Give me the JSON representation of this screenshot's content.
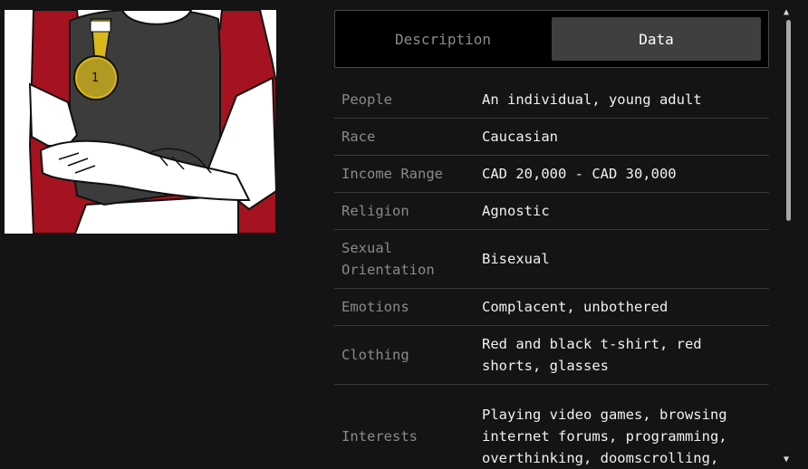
{
  "tabs": {
    "description_label": "Description",
    "data_label": "Data",
    "active": "Data"
  },
  "rows": [
    {
      "label": "People",
      "value": "An individual, young adult"
    },
    {
      "label": "Race",
      "value": "Caucasian"
    },
    {
      "label": "Income Range",
      "value": "CAD 20,000 - CAD 30,000"
    },
    {
      "label": "Religion",
      "value": "Agnostic"
    },
    {
      "label": "Sexual\nOrientation",
      "value": "Bisexual"
    },
    {
      "label": "Emotions",
      "value": "Complacent, unbothered"
    },
    {
      "label": "Clothing",
      "value": "Red and black t-shirt, red shorts, glasses"
    },
    {
      "label": "Interests",
      "value": "Playing video games, browsing internet forums, programming, overthinking, doomscrolling,"
    }
  ],
  "artwork": {
    "medal_text": "1",
    "colors": {
      "shirt_red": "#a4131f",
      "shirt_black": "#3c3c3c",
      "medal": "#d8b81a"
    }
  },
  "scrollbar": {
    "up_icon": "chevron-up-icon",
    "down_icon": "chevron-down-icon"
  }
}
